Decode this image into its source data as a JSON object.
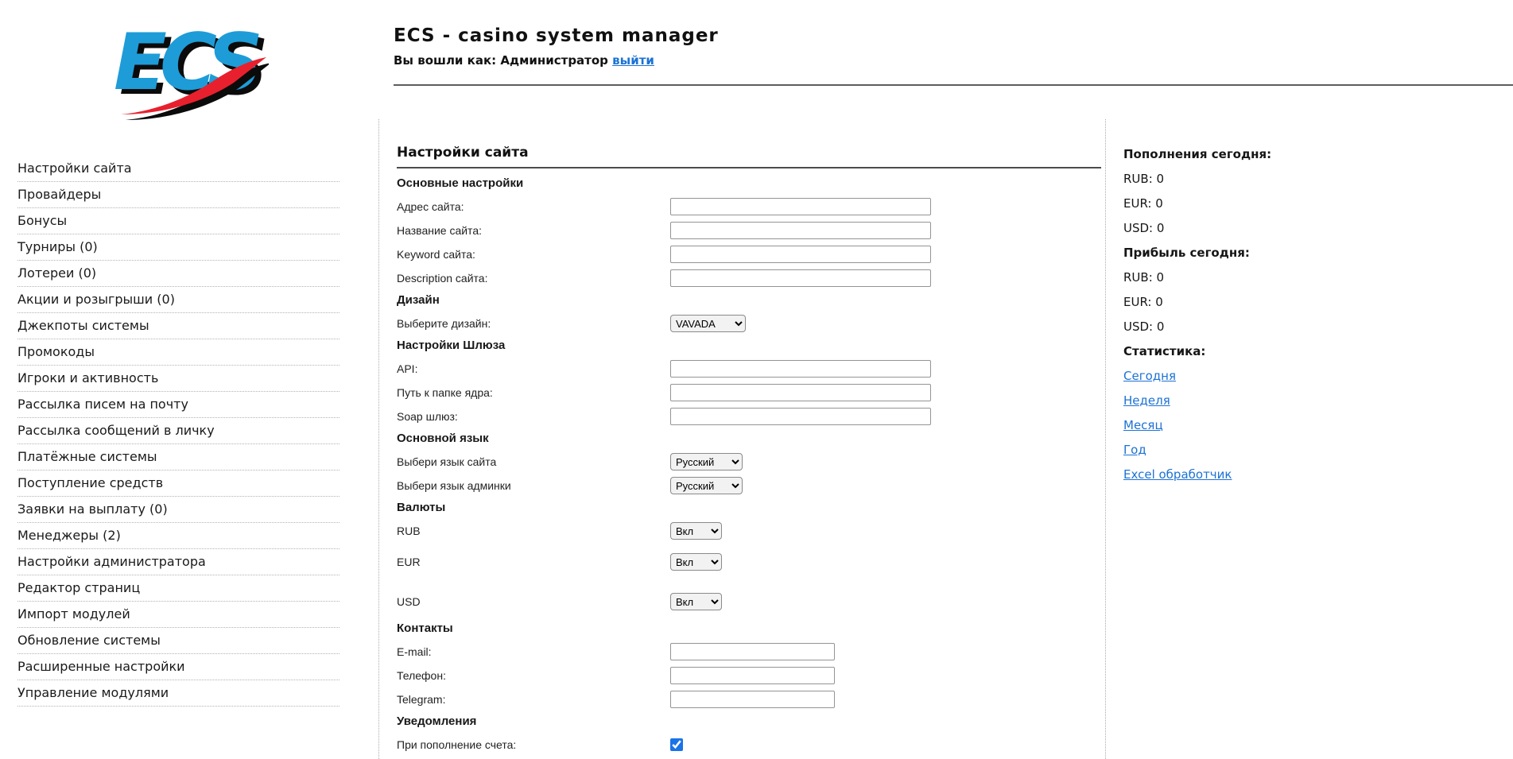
{
  "header": {
    "logo_text": "ECS",
    "title": "ECS - casino system manager",
    "login_label": "Вы вошли как: Администратор",
    "logout_label": "выйти"
  },
  "sidebar": {
    "items": [
      {
        "id": "site-settings",
        "label": "Настройки сайта"
      },
      {
        "id": "providers",
        "label": "Провайдеры"
      },
      {
        "id": "bonuses",
        "label": "Бонусы"
      },
      {
        "id": "tournaments",
        "label": "Турниры (0)"
      },
      {
        "id": "lotteries",
        "label": "Лотереи (0)"
      },
      {
        "id": "promotions",
        "label": "Акции и розыгрыши (0)"
      },
      {
        "id": "jackpots",
        "label": "Джекпоты системы"
      },
      {
        "id": "promocodes",
        "label": "Промокоды"
      },
      {
        "id": "players-activity",
        "label": "Игроки и активность"
      },
      {
        "id": "email-mailing",
        "label": "Рассылка писем на почту"
      },
      {
        "id": "pm-mailing",
        "label": "Рассылка сообщений в личку"
      },
      {
        "id": "payment-systems",
        "label": "Платёжные системы"
      },
      {
        "id": "incoming-funds",
        "label": "Поступление средств"
      },
      {
        "id": "payout-requests",
        "label": "Заявки на выплату (0)"
      },
      {
        "id": "managers",
        "label": "Менеджеры (2)"
      },
      {
        "id": "admin-settings",
        "label": "Настройки администратора"
      },
      {
        "id": "page-editor",
        "label": "Редактор страниц"
      },
      {
        "id": "module-import",
        "label": "Импорт модулей"
      },
      {
        "id": "system-update",
        "label": "Обновление системы"
      },
      {
        "id": "advanced-settings",
        "label": "Расширенные настройки"
      },
      {
        "id": "module-management",
        "label": "Управление модулями"
      }
    ]
  },
  "main": {
    "title": "Настройки сайта",
    "rows": [
      {
        "type": "section",
        "id": "main-settings",
        "label": "Основные настройки"
      },
      {
        "type": "input",
        "id": "site-address",
        "label": "Адрес сайта:",
        "value": "",
        "width": "wide"
      },
      {
        "type": "input",
        "id": "site-name",
        "label": "Название сайта:",
        "value": "",
        "width": "wide"
      },
      {
        "type": "input",
        "id": "site-keyword",
        "label": "Keyword сайта:",
        "value": "",
        "width": "wide"
      },
      {
        "type": "input",
        "id": "site-description",
        "label": "Description сайта:",
        "value": "",
        "width": "wide"
      },
      {
        "type": "section",
        "id": "design",
        "label": "Дизайн"
      },
      {
        "type": "select",
        "id": "design-select",
        "label": "Выберите дизайн:",
        "value": "VAVADA",
        "variant": "design"
      },
      {
        "type": "section",
        "id": "gateway-settings",
        "label": "Настройки Шлюза"
      },
      {
        "type": "input",
        "id": "api",
        "label": "API:",
        "value": "",
        "width": "wide"
      },
      {
        "type": "input",
        "id": "core-path",
        "label": "Путь к папке ядра:",
        "value": "",
        "width": "wide"
      },
      {
        "type": "input",
        "id": "soap-gateway",
        "label": "Soap шлюз:",
        "value": "",
        "width": "wide"
      },
      {
        "type": "section",
        "id": "main-language",
        "label": "Основной язык"
      },
      {
        "type": "select",
        "id": "site-language",
        "label": "Выбери язык сайта",
        "value": "Русский",
        "variant": "lang"
      },
      {
        "type": "select",
        "id": "admin-language",
        "label": "Выбери язык админки",
        "value": "Русский",
        "variant": "lang"
      },
      {
        "type": "section",
        "id": "currencies",
        "label": "Валюты"
      },
      {
        "type": "select",
        "id": "rub",
        "label": "RUB",
        "value": "Вкл",
        "variant": "state",
        "gap": "md"
      },
      {
        "type": "select",
        "id": "eur",
        "label": "EUR",
        "value": "Вкл",
        "variant": "state",
        "gap": "lg"
      },
      {
        "type": "select",
        "id": "usd",
        "label": "USD",
        "value": "Вкл",
        "variant": "state",
        "gap": "sm"
      },
      {
        "type": "section",
        "id": "contacts",
        "label": "Контакты"
      },
      {
        "type": "input",
        "id": "email",
        "label": "E-mail:",
        "value": "",
        "width": "short"
      },
      {
        "type": "input",
        "id": "phone",
        "label": "Телефон:",
        "value": "",
        "width": "short"
      },
      {
        "type": "input",
        "id": "telegram",
        "label": "Telegram:",
        "value": "",
        "width": "short"
      },
      {
        "type": "section",
        "id": "notifications",
        "label": "Уведомления"
      },
      {
        "type": "checkbox",
        "id": "deposit-notification",
        "label": "При пополнение счета:",
        "checked": true
      }
    ]
  },
  "stats": {
    "deposits_title": "Пополнения сегодня:",
    "deposits": [
      "RUB: 0",
      "EUR: 0",
      "USD: 0"
    ],
    "profit_title": "Прибыль сегодня:",
    "profit": [
      "RUB: 0",
      "EUR: 0",
      "USD: 0"
    ],
    "stats_title": "Статистика:",
    "links": [
      {
        "id": "today",
        "label": "Сегодня"
      },
      {
        "id": "week",
        "label": "Неделя"
      },
      {
        "id": "month",
        "label": "Месяц"
      },
      {
        "id": "year",
        "label": "Год"
      },
      {
        "id": "excel",
        "label": "Excel обработчик"
      }
    ]
  },
  "colors": {
    "link_blue": "#1c72d5",
    "logo_blue": "#1e9cd8",
    "logo_red": "#e8202d",
    "logo_shadow": "#0b0b0b",
    "checkbox_blue": "#1a73e8"
  }
}
